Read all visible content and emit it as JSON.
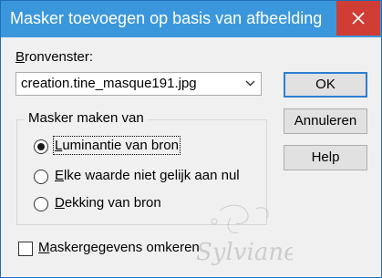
{
  "dialog": {
    "title": "Masker toevoegen op basis van afbeelding"
  },
  "source": {
    "label_accel": "B",
    "label_rest": "ronvenster:",
    "value": "creation.tine_masque191.jpg"
  },
  "buttons": {
    "ok": "OK",
    "cancel": "Annuleren",
    "help": "Help"
  },
  "mask_group": {
    "title": "Masker maken van",
    "options": [
      {
        "accel": "L",
        "rest": "uminantie van bron",
        "checked": true
      },
      {
        "accel": "E",
        "rest": "lke waarde niet gelijk aan nul",
        "checked": false
      },
      {
        "accel": "D",
        "rest": "ekking van bron",
        "checked": false
      }
    ]
  },
  "invert": {
    "accel": "M",
    "rest": "askergegevens omkeren",
    "checked": false
  },
  "watermark": {
    "text": "Sylviane"
  },
  "colors": {
    "titlebar": "#3b97dc",
    "close_button": "#cf3d35",
    "dialog_bg": "#f0f0f0",
    "default_button_border": "#2d7fd0"
  }
}
